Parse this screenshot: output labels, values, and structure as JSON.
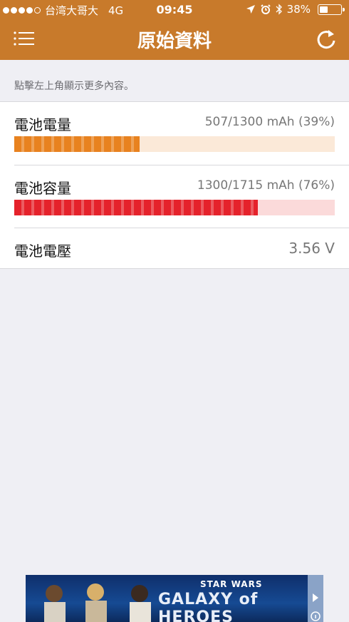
{
  "status_bar": {
    "carrier": "台湾大哥大",
    "network": "4G",
    "time": "09:45",
    "battery_text": "38%",
    "battery_level": 0.38,
    "signal_bars_filled": 4,
    "signal_bars_total": 5
  },
  "nav": {
    "title": "原始資料",
    "menu_icon": "list-menu-icon",
    "refresh_icon": "refresh-icon"
  },
  "hint": "點擊左上角顯示更多內容。",
  "rows": [
    {
      "label": "電池電量",
      "value": "507/1300 mAh (39%)",
      "progress": 0.39,
      "bar_color": "#e8821f",
      "track_color": "#fbe9d8"
    },
    {
      "label": "電池容量",
      "value": "1300/1715 mAh (76%)",
      "progress": 0.76,
      "bar_color": "#e5222b",
      "track_color": "#fbdada"
    },
    {
      "label": "電池電壓",
      "value": "3.56 V"
    }
  ],
  "ad": {
    "brand": "STAR WARS",
    "headline": "GALAXY of HEROES",
    "colors": {
      "background": "#164a93"
    }
  },
  "colors": {
    "accent": "#c87a2b",
    "background": "#efeff4"
  }
}
